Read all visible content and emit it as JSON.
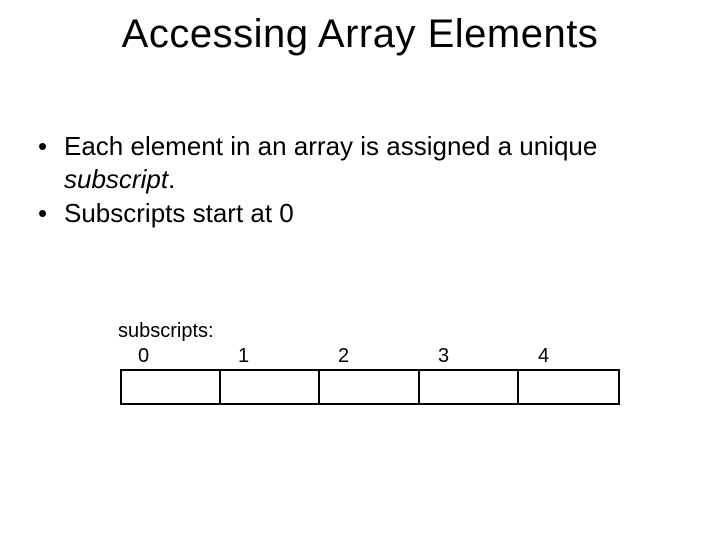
{
  "title": "Accessing Array Elements",
  "bullets": {
    "b1_part1": "Each element in an array is assigned a unique ",
    "b1_italic": "subscript",
    "b1_part2": ".",
    "b2": "Subscripts start at 0"
  },
  "diagram": {
    "label": "subscripts:",
    "indices": [
      "0",
      "1",
      "2",
      "3",
      "4"
    ]
  }
}
